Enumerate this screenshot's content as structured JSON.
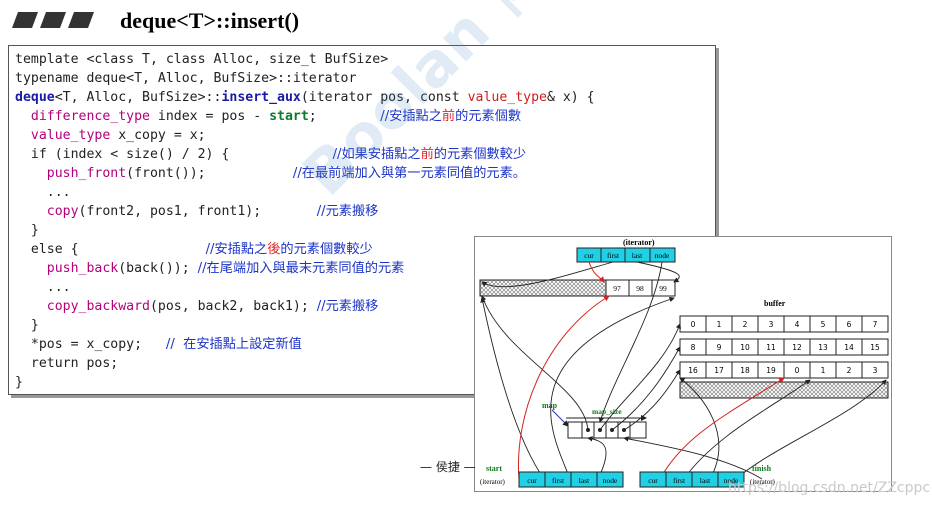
{
  "page": {
    "title": "deque<T>::insert()",
    "annotation_label": "— 侯捷 —",
    "watermark_url": "https://blog.csdn.net/ZZcppc",
    "watermark_brand": "Boolan 博览网"
  },
  "code": {
    "l1": "template <class T, class Alloc, size_t BufSize>",
    "l2": "typename deque<T, Alloc, BufSize>::iterator",
    "l3a": "deque",
    "l3b": "<T, Alloc, BufSize>::",
    "l3c": "insert_aux",
    "l3d": "(iterator pos, const ",
    "l3e": "value_type",
    "l3f": "& x) {",
    "l4a": "  ",
    "l4b": "difference_type",
    "l4c": " index = pos - ",
    "l4d": "start",
    "l4e": ";",
    "c4a": "//安插點之",
    "c4b": "前",
    "c4c": "的元素個數",
    "l5a": "  ",
    "l5b": "value_type",
    "l5c": " x_copy = x;",
    "l6": "  if (index < size() / 2) {",
    "c6a": "//如果安插點之",
    "c6b": "前",
    "c6c": "的元素個數較少",
    "l7a": "    ",
    "l7b": "push_front",
    "l7c": "(front());",
    "c7": "//在最前端加入與第一元素同值的元素。",
    "l8": "    ...",
    "l9a": "    ",
    "l9b": "copy",
    "l9c": "(front2, pos1, front1);",
    "c9": "//元素搬移",
    "l10": "  }",
    "l11": "  else {",
    "c11a": "//安插點之",
    "c11b": "後",
    "c11c": "的元素個數較少",
    "l12a": "    ",
    "l12b": "push_back",
    "l12c": "(back());",
    "c12": "//在尾端加入與最末元素同值的元素",
    "l13": "    ...",
    "l14a": "    ",
    "l14b": "copy_backward",
    "l14c": "(pos, back2, back1);",
    "c14": "//元素搬移",
    "l15": "  }",
    "l16": "  *pos = x_copy;",
    "c16": "//  在安插點上設定新值",
    "l17": "  return pos;",
    "l18": "}"
  },
  "diagram": {
    "iterator_label": "(iterator)",
    "iter_cells": [
      "cur",
      "first",
      "last",
      "node"
    ],
    "buffer_label": "buffer",
    "top_buffer_values": [
      "97",
      "98",
      "99"
    ],
    "row1": [
      "0",
      "1",
      "2",
      "3",
      "4",
      "5",
      "6",
      "7"
    ],
    "row2": [
      "8",
      "9",
      "10",
      "11",
      "12",
      "13",
      "14",
      "15"
    ],
    "row3": [
      "16",
      "17",
      "18",
      "19",
      "0",
      "1",
      "2",
      "3"
    ],
    "map_label": "map",
    "map_size_label": "map_size",
    "start_label": "start",
    "start_sub": "(iterator)",
    "finish_label": "finish",
    "finish_sub": "(iterator)",
    "colors": {
      "cell_cyan": "#22d0e6",
      "green_label": "#0a7a1a",
      "red_arrow": "#d42020",
      "blue_pointer": "#2030c0"
    }
  }
}
